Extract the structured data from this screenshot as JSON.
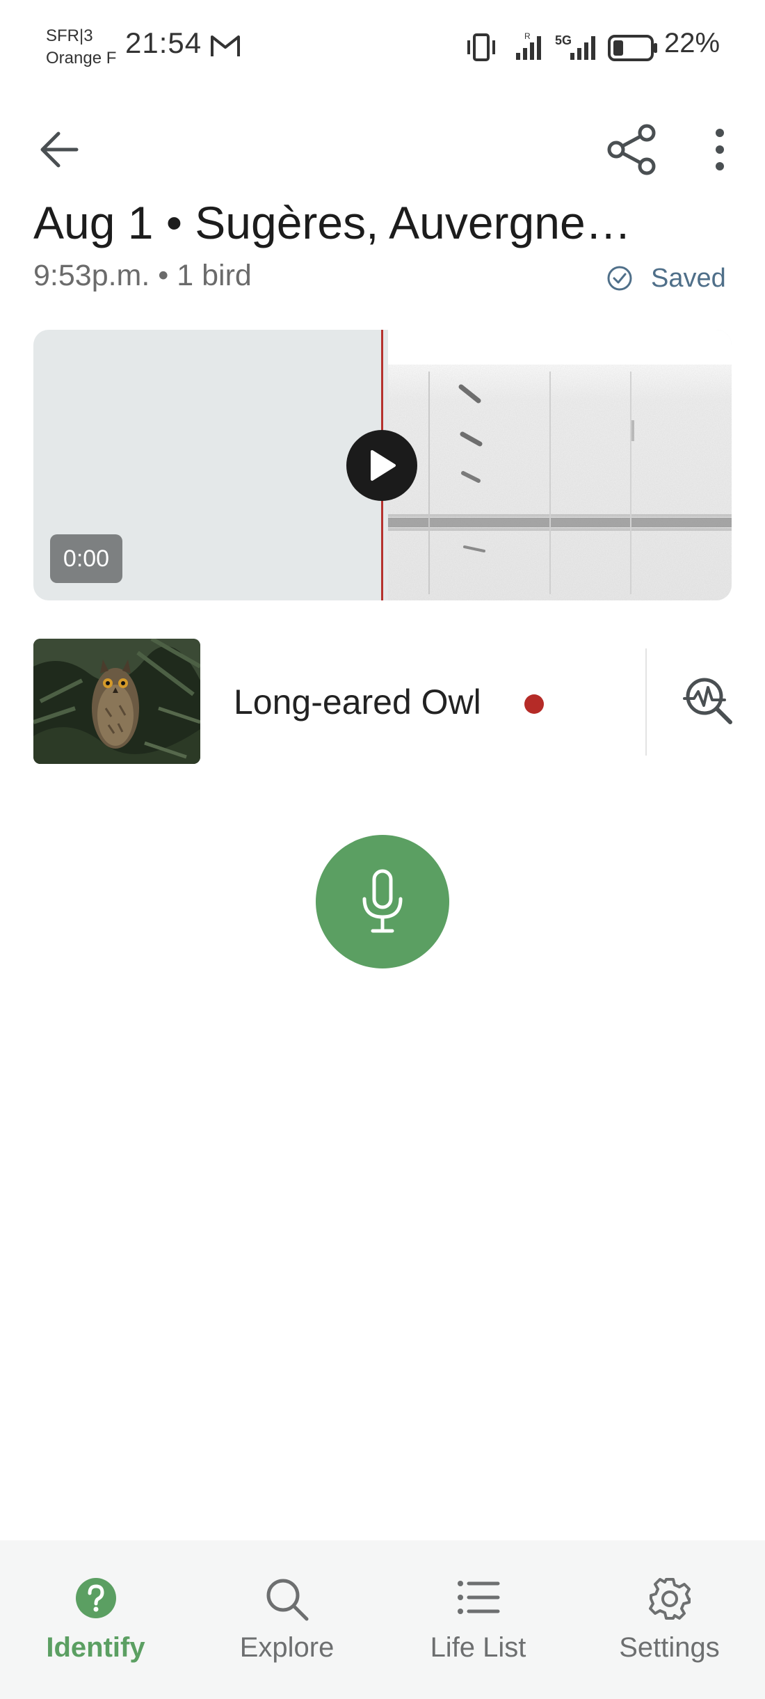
{
  "status_bar": {
    "carrier_line1": "SFR|3",
    "carrier_line2": "Orange F",
    "time": "21:54",
    "battery": "22%",
    "network": "5G"
  },
  "header": {
    "title": "Aug 1 • Sugères, Auvergne…",
    "subtitle": "9:53p.m. • 1 bird",
    "saved_label": "Saved"
  },
  "player": {
    "time": "0:00"
  },
  "species": [
    {
      "name": "Long-eared Owl",
      "indicator_color": "#b52b27"
    }
  ],
  "nav": {
    "items": [
      {
        "label": "Identify",
        "icon": "question-circle-icon",
        "active": true
      },
      {
        "label": "Explore",
        "icon": "search-icon",
        "active": false
      },
      {
        "label": "Life List",
        "icon": "list-icon",
        "active": false
      },
      {
        "label": "Settings",
        "icon": "gear-icon",
        "active": false
      }
    ]
  },
  "colors": {
    "accent_green": "#5b9f62",
    "saved_blue": "#4f6f89",
    "playhead_red": "#b5322e"
  }
}
